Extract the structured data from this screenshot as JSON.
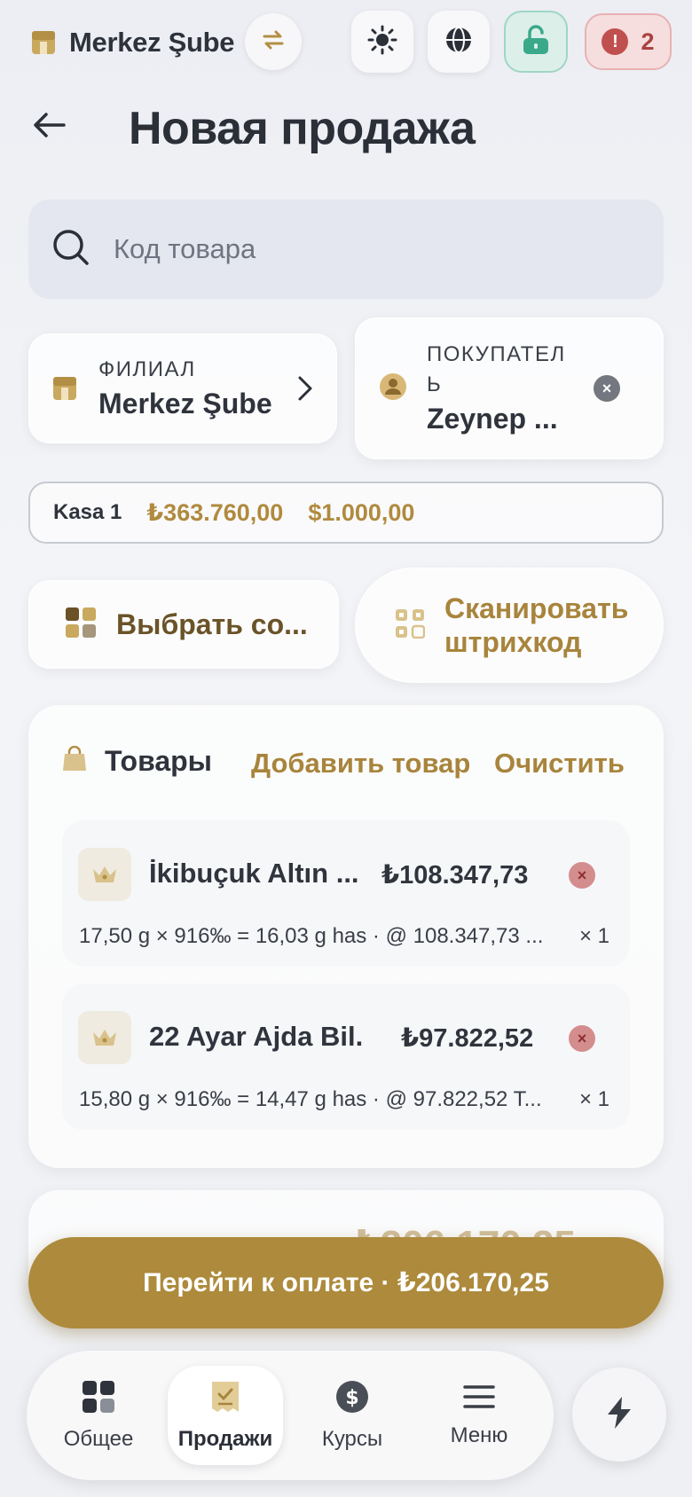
{
  "header": {
    "branch_name": "Merkez Şube",
    "alert_count": "2"
  },
  "page": {
    "title": "Новая продажа"
  },
  "search": {
    "placeholder": "Код товара"
  },
  "branch_card": {
    "label": "ФИЛИАЛ",
    "value": "Merkez Şube"
  },
  "customer_card": {
    "label_line1": "ПОКУПАТЕЛ",
    "label_line2": "Ь",
    "value": "Zeynep ..."
  },
  "kasa": {
    "name": "Kasa 1",
    "amount_try": "₺363.760,00",
    "amount_usd": "$1.000,00"
  },
  "actions": {
    "select_label": "Выбрать со...",
    "scan_line1": "Сканировать",
    "scan_line2": "штрихкод"
  },
  "products": {
    "title": "Товары",
    "add_label": "Добавить товар",
    "clear_label": "Очистить",
    "items": [
      {
        "name": "İkibuçuk Altın ...",
        "price": "₺108.347,73",
        "detail": "17,50 g × 916‰ = 16,03 g has · @ 108.347,73 ...",
        "qty": "× 1"
      },
      {
        "name": "22 Ayar Ajda Bil...",
        "price": "₺97.822,52",
        "detail": "15,80 g × 916‰ = 14,47 g has · @ 97.822,52 T...",
        "qty": "× 1"
      }
    ]
  },
  "summary": {
    "total_partial": "₺206.170,25"
  },
  "pay_button": {
    "label": "Перейти к оплате · ₺206.170,25"
  },
  "nav": {
    "items": [
      {
        "label": "Общее"
      },
      {
        "label": "Продажи"
      },
      {
        "label": "Курсы"
      },
      {
        "label": "Меню"
      }
    ]
  },
  "colors": {
    "accent": "#ad8a3c",
    "alert": "#c0504f",
    "lock": "#9fd6c6"
  }
}
